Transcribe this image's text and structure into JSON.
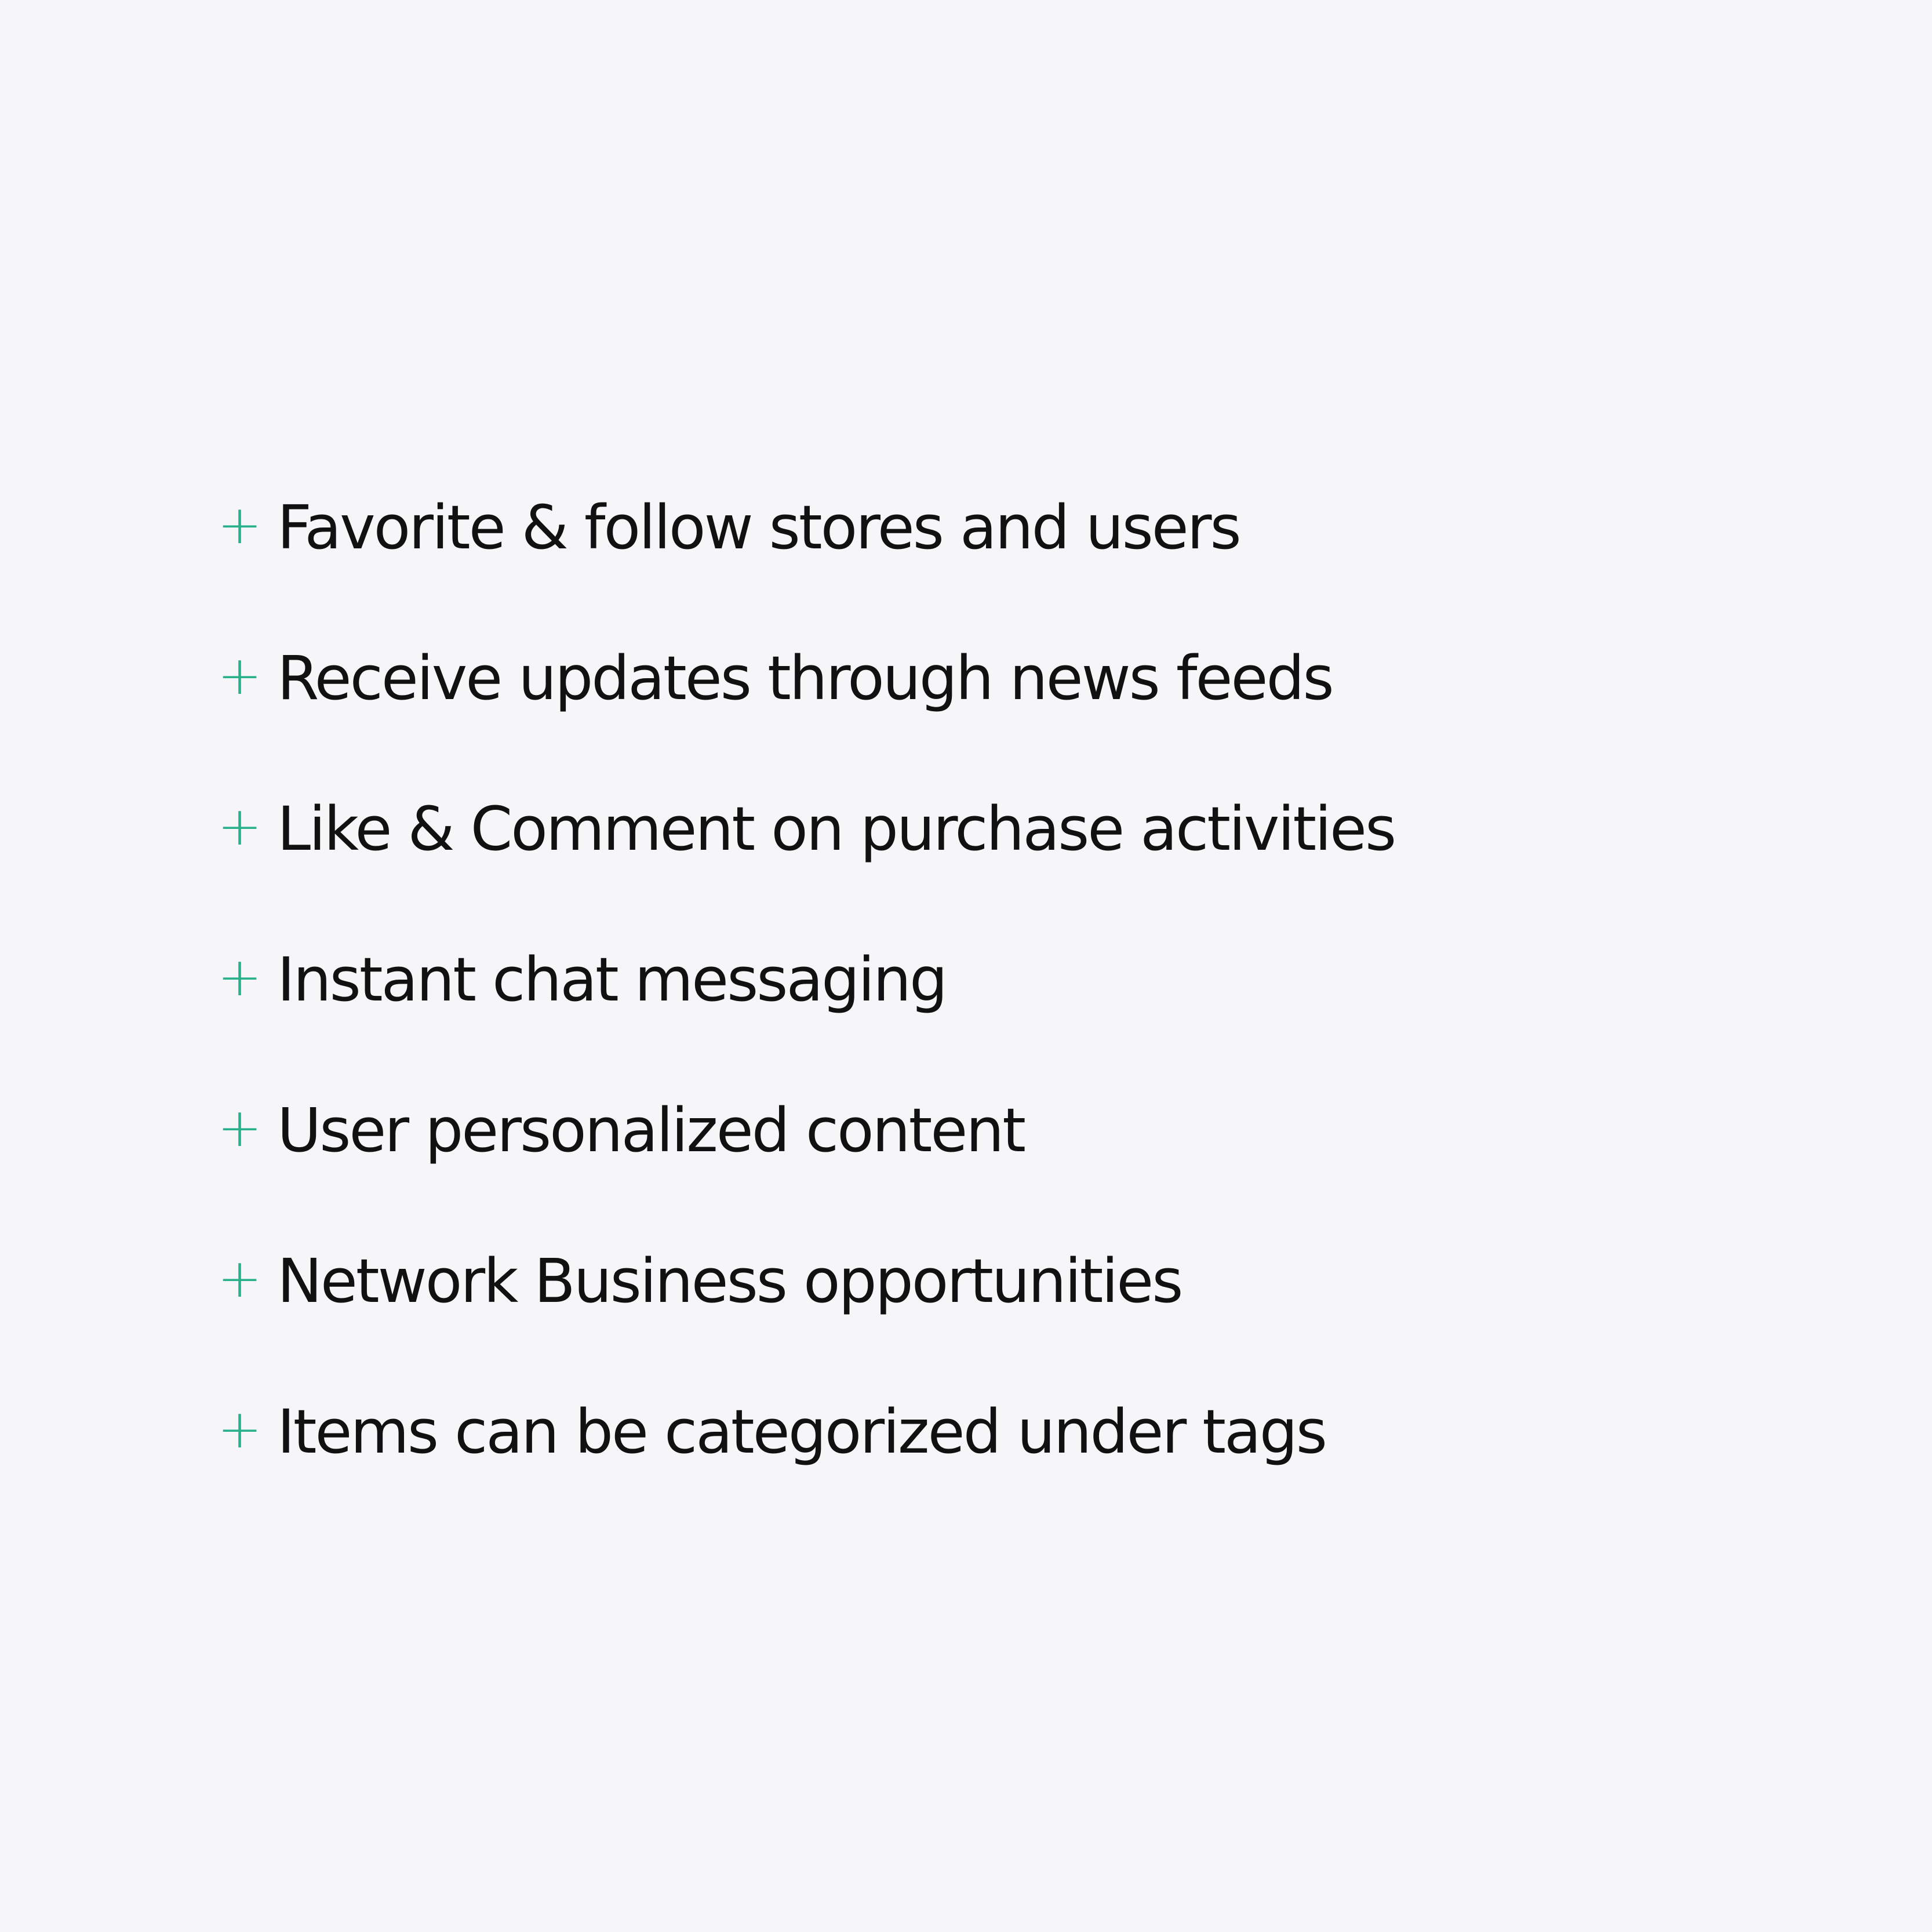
{
  "colors": {
    "background": "#f6f6f8",
    "accent": "#28b08a",
    "text": "#111111"
  },
  "bullet_icon": "plus-icon",
  "bullet_glyph": "+",
  "features": [
    {
      "label": "Favorite & follow stores and users"
    },
    {
      "label": "Receive updates through news feeds"
    },
    {
      "label": "Like & Comment on purchase activities"
    },
    {
      "label": "Instant chat messaging"
    },
    {
      "label": "User personalized content"
    },
    {
      "label": "Network Business opportunities"
    },
    {
      "label": "Items can be categorized under tags"
    }
  ]
}
